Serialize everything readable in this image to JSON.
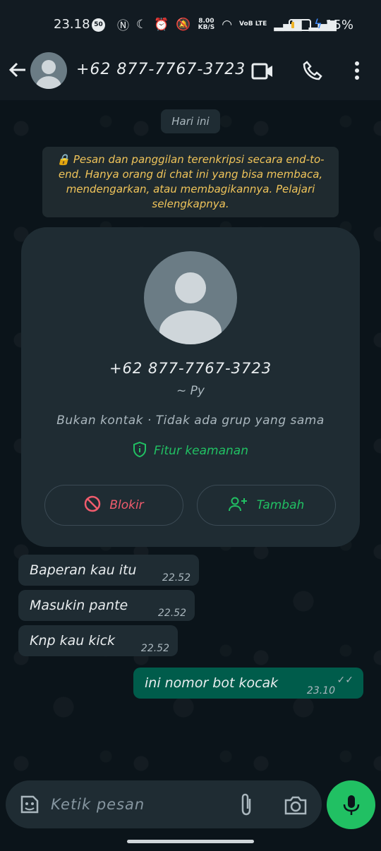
{
  "status_bar": {
    "time": "23.18",
    "badge": "50",
    "speed_top": "8.00",
    "speed_unit": "KB/S",
    "volte": "VoB LTE",
    "battery_percent": "15%",
    "battery_level": 0.15
  },
  "header": {
    "contact": "+62 877-7767-3723"
  },
  "chat": {
    "date_chip": "Hari ini",
    "encryption_notice": "🔒 Pesan dan panggilan terenkripsi secara end-to-end. Hanya orang di chat ini yang bisa membaca, mendengarkan, atau membagikannya. Pelajari selengkapnya."
  },
  "contact_card": {
    "number": "+62 877-7767-3723",
    "name": "~ Py",
    "info": "Bukan kontak · Tidak ada grup yang sama",
    "security": "Fitur keamanan",
    "block_label": "Blokir",
    "add_label": "Tambah"
  },
  "messages": [
    {
      "text": "Baperan kau itu",
      "time": "22.52",
      "direction": "in"
    },
    {
      "text": "Masukin pante",
      "time": "22.52",
      "direction": "in"
    },
    {
      "text": "Knp kau kick",
      "time": "22.52",
      "direction": "in"
    },
    {
      "text": "ini nomor bot kocak",
      "time": "23.10",
      "direction": "out"
    }
  ],
  "composer": {
    "placeholder": "Ketik pesan"
  },
  "colors": {
    "accent": "#21c063",
    "outgoing": "#005c4b",
    "incoming": "#1f2c33",
    "danger": "#f15c6d"
  }
}
